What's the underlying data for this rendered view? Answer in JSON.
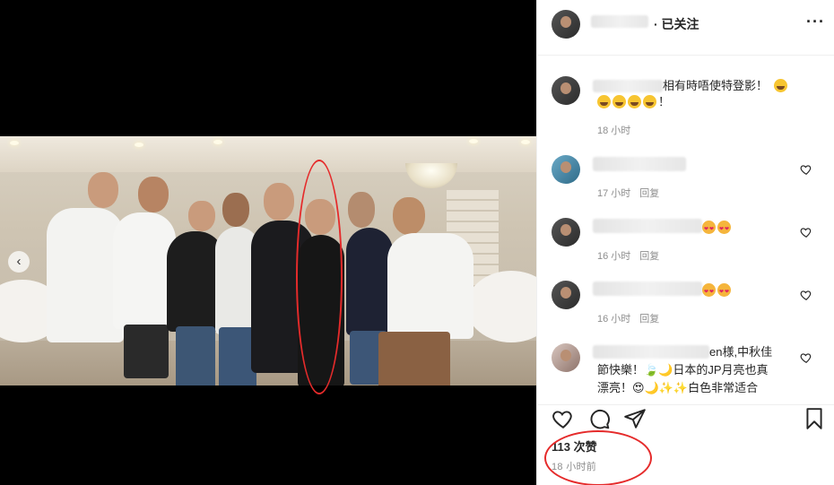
{
  "post": {
    "follow_state": "· 已关注",
    "more_label": "···",
    "nav_prev": "‹"
  },
  "comments": [
    {
      "text": "相有時唔使特登影！",
      "emojis": "😂😂😂😂！",
      "time": "18 小时",
      "reply": ""
    },
    {
      "text": "",
      "emojis": "",
      "time": "17 小时",
      "reply": "回复"
    },
    {
      "text": "",
      "emojis": "😍😍",
      "time": "16 小时",
      "reply": "回复"
    },
    {
      "text": "",
      "emojis": "😍😍",
      "time": "16 小时",
      "reply": "回复"
    },
    {
      "text_line1": "en様,中秋佳",
      "text_line2": "節快樂！🍃🌙日本的JP月亮也真",
      "text_line3": "漂亮！😍🌙✨✨白色非常适合"
    }
  ],
  "footer": {
    "likes": "113 次赞",
    "time_ago": "18 小时前"
  },
  "colors": {
    "annotation_red": "#e52b2b",
    "muted_text": "#8e8e8e",
    "primary_text": "#262626"
  },
  "icons": [
    "heart-icon",
    "comment-icon",
    "share-icon",
    "bookmark-icon",
    "more-icon",
    "chevron-left-icon"
  ]
}
